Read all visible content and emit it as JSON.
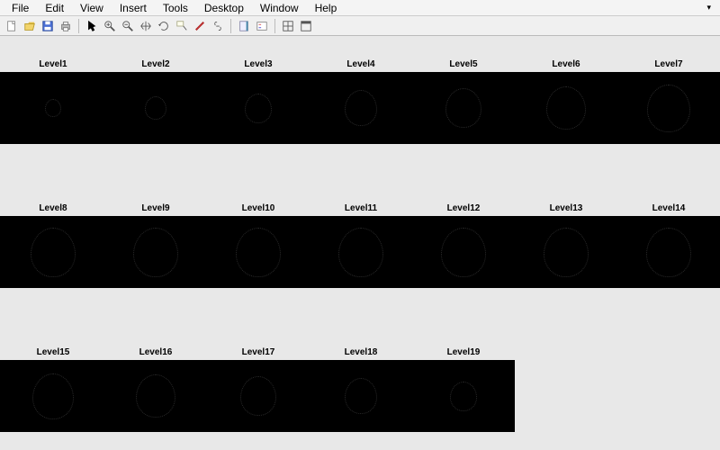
{
  "menubar": {
    "items": [
      "File",
      "Edit",
      "View",
      "Insert",
      "Tools",
      "Desktop",
      "Window",
      "Help"
    ]
  },
  "toolbar": {
    "buttons": [
      {
        "name": "new-figure-icon"
      },
      {
        "name": "open-icon"
      },
      {
        "name": "save-icon"
      },
      {
        "name": "print-icon"
      },
      {
        "sep": true
      },
      {
        "name": "pointer-icon"
      },
      {
        "name": "zoom-in-icon"
      },
      {
        "name": "zoom-out-icon"
      },
      {
        "name": "pan-icon"
      },
      {
        "name": "rotate-icon"
      },
      {
        "name": "data-cursor-icon"
      },
      {
        "name": "brush-icon"
      },
      {
        "name": "link-icon"
      },
      {
        "sep": true
      },
      {
        "name": "colorbar-icon"
      },
      {
        "name": "legend-icon"
      },
      {
        "sep": true
      },
      {
        "name": "layout-icon"
      },
      {
        "name": "dock-icon"
      }
    ]
  },
  "figure": {
    "rows": 3,
    "cols": 7,
    "subplots": [
      {
        "title": "Level1"
      },
      {
        "title": "Level2"
      },
      {
        "title": "Level3"
      },
      {
        "title": "Level4"
      },
      {
        "title": "Level5"
      },
      {
        "title": "Level6"
      },
      {
        "title": "Level7"
      },
      {
        "title": "Level8"
      },
      {
        "title": "Level9"
      },
      {
        "title": "Level10"
      },
      {
        "title": "Level11"
      },
      {
        "title": "Level12"
      },
      {
        "title": "Level13"
      },
      {
        "title": "Level14"
      },
      {
        "title": "Level15"
      },
      {
        "title": "Level16"
      },
      {
        "title": "Level17"
      },
      {
        "title": "Level18"
      },
      {
        "title": "Level19"
      }
    ],
    "shape_sizes": [
      18,
      24,
      30,
      36,
      40,
      44,
      48,
      50,
      50,
      50,
      50,
      50,
      50,
      50,
      46,
      44,
      40,
      36,
      30
    ]
  }
}
